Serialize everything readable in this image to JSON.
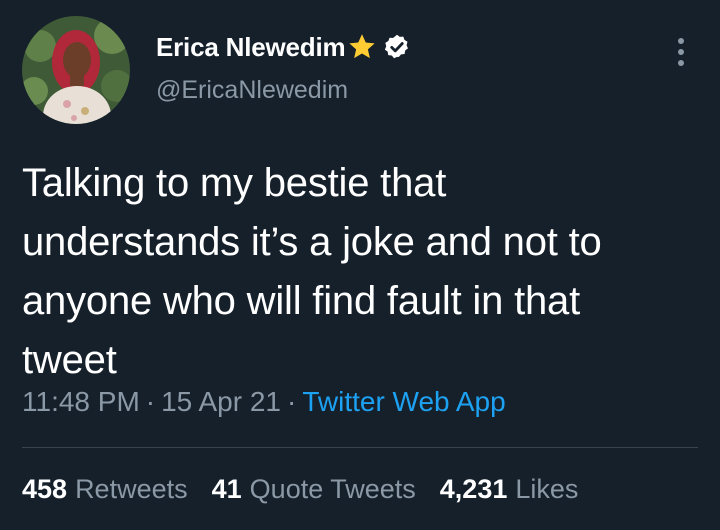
{
  "user": {
    "display_name": "Erica Nlewedim",
    "emoji": "star",
    "verified": true,
    "handle": "@EricaNlewedim"
  },
  "tweet": {
    "text": "Talking to my bestie that\nunderstands it’s a joke and not to\nanyone who will find fault in that\ntweet",
    "time": "11:48 PM",
    "separator": "·",
    "date": "15 Apr 21",
    "source": "Twitter Web App"
  },
  "stats": {
    "retweets": {
      "count": "458",
      "label": "Retweets"
    },
    "quotes": {
      "count": "41",
      "label": "Quote Tweets"
    },
    "likes": {
      "count": "4,231",
      "label": "Likes"
    }
  },
  "icons": {
    "more": "more-vertical-icon",
    "verified": "verified-badge-icon",
    "star": "star-emoji-icon"
  },
  "colors": {
    "background": "#15202b",
    "accent": "#1da1f2",
    "secondary_text": "#8b98a5",
    "divider": "#38444d"
  }
}
